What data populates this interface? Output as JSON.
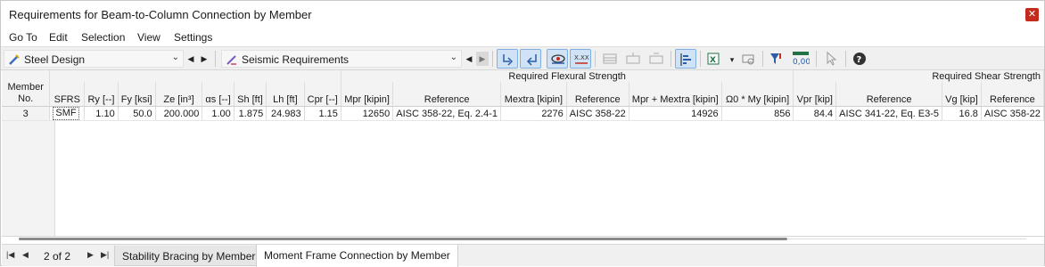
{
  "window": {
    "title": "Requirements for Beam-to-Column Connection by Member"
  },
  "menu": [
    "Go To",
    "Edit",
    "Selection",
    "View",
    "Settings"
  ],
  "toolbar": {
    "module_select": "Steel Design",
    "view_select": "Seismic Requirements",
    "zero_badge": "0,00",
    "xxx_label": "X.XX"
  },
  "table": {
    "group_headers": {
      "flexural": "Required Flexural Strength",
      "shear": "Required Shear Strength"
    },
    "member_header_1": "Member",
    "member_header_2": "No.",
    "columns": [
      {
        "key": "sfrs",
        "label": "SFRS"
      },
      {
        "key": "ry",
        "label": "Ry [--]"
      },
      {
        "key": "fy",
        "label": "Fy [ksi]"
      },
      {
        "key": "ze",
        "label": "Ze [in³]"
      },
      {
        "key": "as",
        "label": "αs [--]"
      },
      {
        "key": "sh",
        "label": "Sh [ft]"
      },
      {
        "key": "lh",
        "label": "Lh [ft]"
      },
      {
        "key": "cpr",
        "label": "Cpr [--]"
      },
      {
        "key": "mpr",
        "label": "Mpr [kipin]"
      },
      {
        "key": "ref1",
        "label": "Reference"
      },
      {
        "key": "mextra",
        "label": "Mextra [kipin]"
      },
      {
        "key": "ref2",
        "label": "Reference"
      },
      {
        "key": "mprmextra",
        "label": "Mpr + Mextra [kipin]"
      },
      {
        "key": "omega",
        "label": "Ω0 * My [kipin]"
      },
      {
        "key": "vpr",
        "label": "Vpr [kip]"
      },
      {
        "key": "ref3",
        "label": "Reference"
      },
      {
        "key": "vg",
        "label": "Vg [kip]"
      },
      {
        "key": "ref4",
        "label": "Reference"
      }
    ],
    "rows": [
      {
        "member": "3",
        "sfrs": "SMF",
        "ry": "1.10",
        "fy": "50.0",
        "ze": "200.000",
        "as": "1.00",
        "sh": "1.875",
        "lh": "24.983",
        "cpr": "1.15",
        "mpr": "12650",
        "ref1": "AISC 358-22, Eq. 2.4-1",
        "mextra": "2276",
        "ref2": "AISC 358-22",
        "mprmextra": "14926",
        "omega": "856",
        "vpr": "84.4",
        "ref3": "AISC 341-22, Eq. E3-5",
        "vg": "16.8",
        "ref4": "AISC 358-22"
      }
    ]
  },
  "footer": {
    "page_info": "2 of 2",
    "tabs": [
      {
        "label": "Stability Bracing by Member",
        "active": false
      },
      {
        "label": "Moment Frame Connection by Member",
        "active": true
      }
    ]
  },
  "colors": {
    "accent": "#cfe2f6",
    "close": "#c42b1c"
  }
}
